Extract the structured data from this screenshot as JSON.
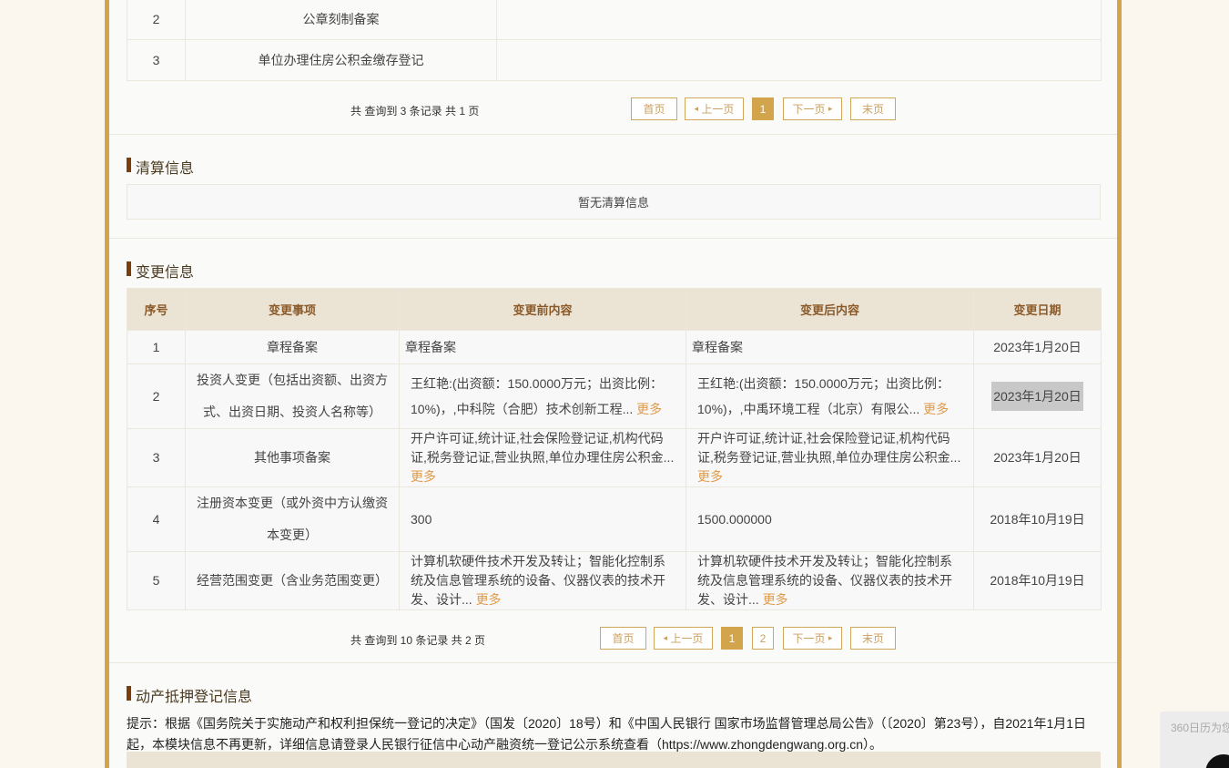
{
  "top_table": {
    "rows": [
      {
        "no": "2",
        "item": "公章刻制备案",
        "extra": ""
      },
      {
        "no": "3",
        "item": "单位办理住房公积金缴存登记",
        "extra": ""
      }
    ]
  },
  "pager1": {
    "total": "共 查询到 3 条记录 共 1 页",
    "first": "首页",
    "prev": "上一页",
    "pages": [
      "1"
    ],
    "next": "下一页",
    "last": "末页"
  },
  "liquidation": {
    "title": "清算信息",
    "empty": "暂无清算信息"
  },
  "changes": {
    "title": "变更信息",
    "headers": [
      "序号",
      "变更事项",
      "变更前内容",
      "变更后内容",
      "变更日期"
    ],
    "more_label": "更多",
    "rows": [
      {
        "no": "1",
        "item": "章程备案",
        "before": "章程备案",
        "after": "章程备案",
        "date": "2023年1月20日"
      },
      {
        "no": "2",
        "item": "投资人变更（包括出资额、出资方式、出资日期、投资人名称等）",
        "before": "王红艳:(出资额：150.0000万元；出资比例：10%)，,中科院（合肥）技术创新工程...",
        "after": "王红艳:(出资额：150.0000万元；出资比例：10%)，,中禹环境工程（北京）有限公...",
        "date": "2023年1月20日"
      },
      {
        "no": "3",
        "item": "其他事项备案",
        "before": "开户许可证,统计证,社会保险登记证,机构代码证,税务登记证,营业执照,单位办理住房公积金...",
        "after": "开户许可证,统计证,社会保险登记证,机构代码证,税务登记证,营业执照,单位办理住房公积金...",
        "date": "2023年1月20日"
      },
      {
        "no": "4",
        "item": "注册资本变更（或外资中方认缴资本变更）",
        "before": "300",
        "after": "1500.000000",
        "date": "2018年10月19日"
      },
      {
        "no": "5",
        "item": "经营范围变更（含业务范围变更）",
        "before": "计算机软硬件技术开发及转让；智能化控制系统及信息管理系统的设备、仪器仪表的技术开发、设计...",
        "after": "计算机软硬件技术开发及转让；智能化控制系统及信息管理系统的设备、仪器仪表的技术开发、设计...",
        "date": "2018年10月19日"
      }
    ]
  },
  "pager2": {
    "total": "共 查询到 10 条记录 共 2 页",
    "first": "首页",
    "prev": "上一页",
    "pages": [
      "1",
      "2"
    ],
    "next": "下一页",
    "last": "末页"
  },
  "mortgage": {
    "title": "动产抵押登记信息",
    "notice": "提示：根据《国务院关于实施动产和权利担保统一登记的决定》（国发〔2020〕18号）和《中国人民银行 国家市场监督管理总局公告》（〔2020〕第23号），自2021年1月1日起，本模块信息不再更新，详细信息请登录人民银行征信中心动产融资统一登记公示系统查看（https://www.zhongdengwang.org.cn）。"
  },
  "side_widget": {
    "text": "360日历为您"
  }
}
